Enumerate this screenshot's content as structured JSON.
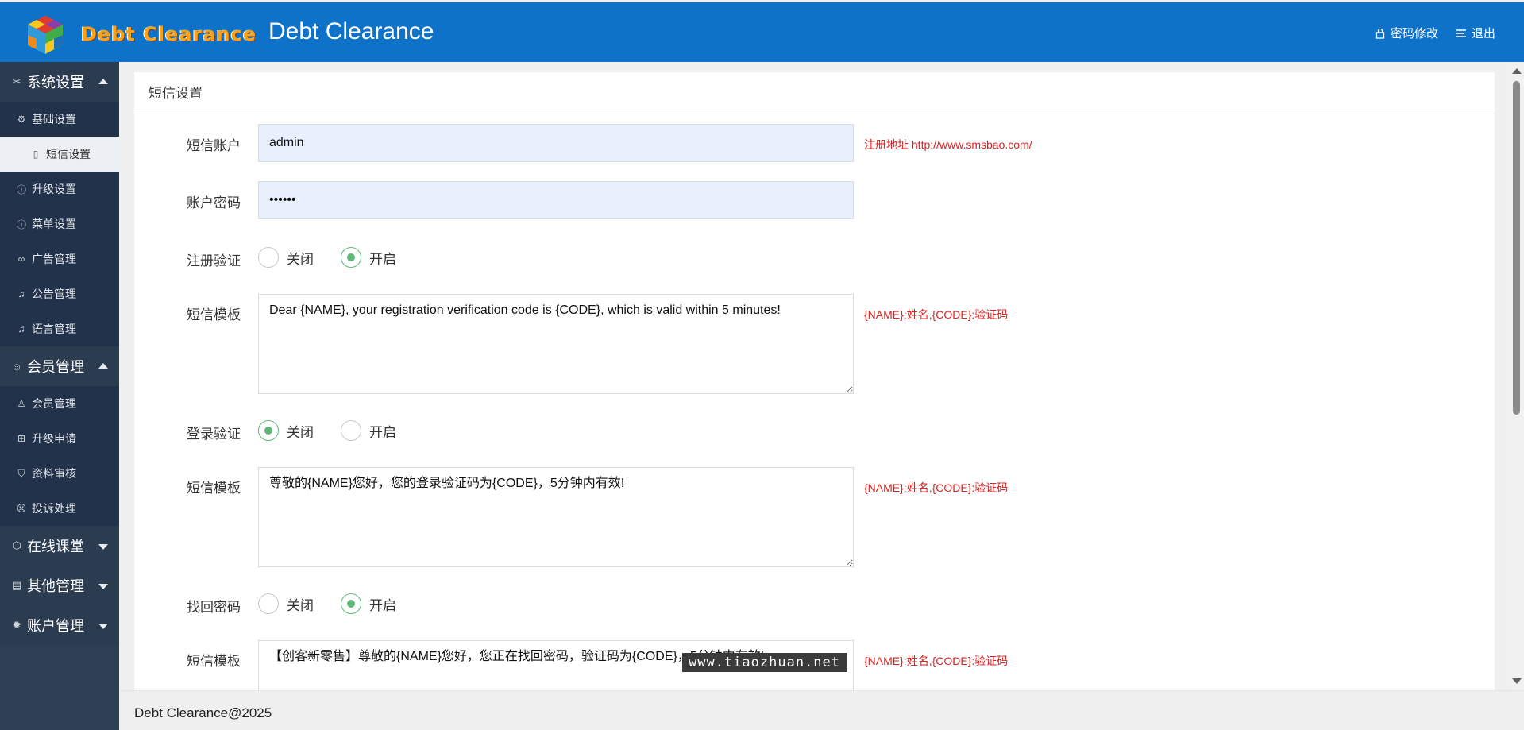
{
  "header": {
    "logo_text": "Debt Clearance",
    "app_title": "Debt Clearance",
    "change_password": "密码修改",
    "logout": "退出"
  },
  "sidebar": {
    "groups": [
      {
        "label": "系统设置",
        "icon": "tools-icon",
        "expanded": true
      },
      {
        "label": "会员管理",
        "icon": "user-circle-icon",
        "expanded": true
      },
      {
        "label": "在线课堂",
        "icon": "cube-icon",
        "expanded": false
      },
      {
        "label": "其他管理",
        "icon": "document-icon",
        "expanded": false
      },
      {
        "label": "账户管理",
        "icon": "gear-icon",
        "expanded": false
      }
    ],
    "system_items": {
      "basic": "基础设置",
      "sms": "短信设置",
      "upgrade": "升级设置",
      "menu": "菜单设置",
      "ads": "广告管理",
      "notice": "公告管理",
      "language": "语言管理"
    },
    "member_items": {
      "members": "会员管理",
      "upgrade_apply": "升级申请",
      "review": "资料审核",
      "complaints": "投诉处理"
    }
  },
  "panel": {
    "title": "短信设置",
    "account_label": "短信账户",
    "account_value": "admin",
    "account_hint": "注册地址 http://www.smsbao.com/",
    "password_label": "账户密码",
    "password_value": "••••••",
    "register_label": "注册验证",
    "off_label": "关闭",
    "on_label": "开启",
    "register_state": "on",
    "template_label": "短信模板",
    "register_template": "Dear {NAME}, your registration verification code is {CODE}, which is valid within 5 minutes!",
    "template_hint": "{NAME}:姓名,{CODE}:验证码",
    "login_label": "登录验证",
    "login_state": "off",
    "login_template": "尊敬的{NAME}您好，您的登录验证码为{CODE}，5分钟内有效!",
    "recover_label": "找回密码",
    "recover_state": "on",
    "recover_template": "【创客新零售】尊敬的{NAME}您好，您正在找回密码，验证码为{CODE}，5分钟内有效!"
  },
  "watermark": "www.tiaozhuan.net",
  "footer": {
    "text": "Debt Clearance@2025"
  },
  "colors": {
    "header_bg": "#0f72c9",
    "sidebar_bg": "#2e3e53",
    "radio_checked": "#5fb878",
    "hint_red": "#e02020"
  }
}
